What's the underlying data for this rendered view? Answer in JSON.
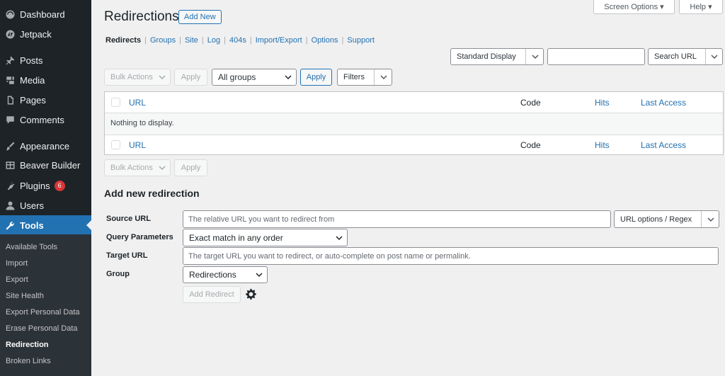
{
  "sidebar": {
    "items": [
      {
        "label": "Dashboard",
        "icon": "dashboard-icon"
      },
      {
        "label": "Jetpack",
        "icon": "jetpack-icon"
      },
      {
        "label": "Posts",
        "icon": "pin-icon"
      },
      {
        "label": "Media",
        "icon": "media-icon"
      },
      {
        "label": "Pages",
        "icon": "pages-icon"
      },
      {
        "label": "Comments",
        "icon": "comment-icon"
      },
      {
        "label": "Appearance",
        "icon": "brush-icon"
      },
      {
        "label": "Beaver Builder",
        "icon": "grid-icon"
      },
      {
        "label": "Plugins",
        "icon": "plug-icon",
        "badge": "6"
      },
      {
        "label": "Users",
        "icon": "user-icon"
      },
      {
        "label": "Tools",
        "icon": "wrench-icon"
      }
    ],
    "submenu": [
      "Available Tools",
      "Import",
      "Export",
      "Site Health",
      "Export Personal Data",
      "Erase Personal Data",
      "Redirection",
      "Broken Links"
    ]
  },
  "top": {
    "screen_options": "Screen Options ▾",
    "help": "Help ▾"
  },
  "page": {
    "title": "Redirections",
    "add_new": "Add New"
  },
  "subnav": [
    "Redirects",
    "Groups",
    "Site",
    "Log",
    "404s",
    "Import/Export",
    "Options",
    "Support"
  ],
  "toolbar": {
    "display_select": "Standard Display",
    "search_value": "",
    "search_button": "Search URL",
    "bulk_actions": "Bulk Actions",
    "apply": "Apply",
    "group_select": "All groups",
    "apply_active": "Apply",
    "filters": "Filters"
  },
  "table": {
    "headers": {
      "url": "URL",
      "code": "Code",
      "hits": "Hits",
      "last_access": "Last Access"
    },
    "empty_message": "Nothing to display."
  },
  "bottom_toolbar": {
    "bulk_actions": "Bulk Actions",
    "apply": "Apply"
  },
  "form": {
    "title": "Add new redirection",
    "source_label": "Source URL",
    "source_placeholder": "The relative URL you want to redirect from",
    "url_options": "URL options / Regex",
    "query_label": "Query Parameters",
    "query_value": "Exact match in any order",
    "target_label": "Target URL",
    "target_placeholder": "The target URL you want to redirect, or auto-complete on post name or permalink.",
    "group_label": "Group",
    "group_value": "Redirections",
    "add_button": "Add Redirect"
  }
}
